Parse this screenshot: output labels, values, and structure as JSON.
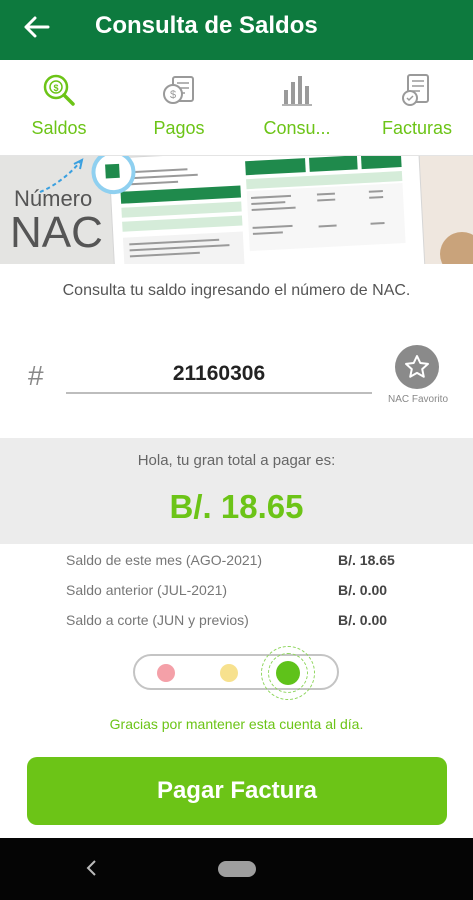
{
  "appbar": {
    "title": "Consulta de Saldos"
  },
  "tabs": [
    {
      "label": "Saldos",
      "icon": "balance-search-icon"
    },
    {
      "label": "Pagos",
      "icon": "payments-icon"
    },
    {
      "label": "Consu...",
      "icon": "bar-chart-icon"
    },
    {
      "label": "Facturas",
      "icon": "invoice-icon"
    }
  ],
  "banner": {
    "label_top": "Número",
    "label_bottom": "NAC"
  },
  "hint": "Consulta tu saldo ingresando el número de NAC.",
  "nac": {
    "value": "21160306",
    "favorite_label": "NAC Favorito"
  },
  "total": {
    "caption": "Hola, tu gran total a pagar es:",
    "amount": "B/. 18.65"
  },
  "balances": [
    {
      "label": "Saldo de este mes (AGO-2021)",
      "value": "B/. 18.65"
    },
    {
      "label": "Saldo anterior (JUL-2021)",
      "value": "B/. 0.00"
    },
    {
      "label": "Saldo a corte (JUN y previos)",
      "value": "B/. 0.00"
    }
  ],
  "status": {
    "active": "green",
    "message": "Gracias por mantener esta cuenta al día."
  },
  "pay_button": "Pagar Factura",
  "colors": {
    "appbar": "#0d7a3e",
    "accent": "#6cc417"
  }
}
